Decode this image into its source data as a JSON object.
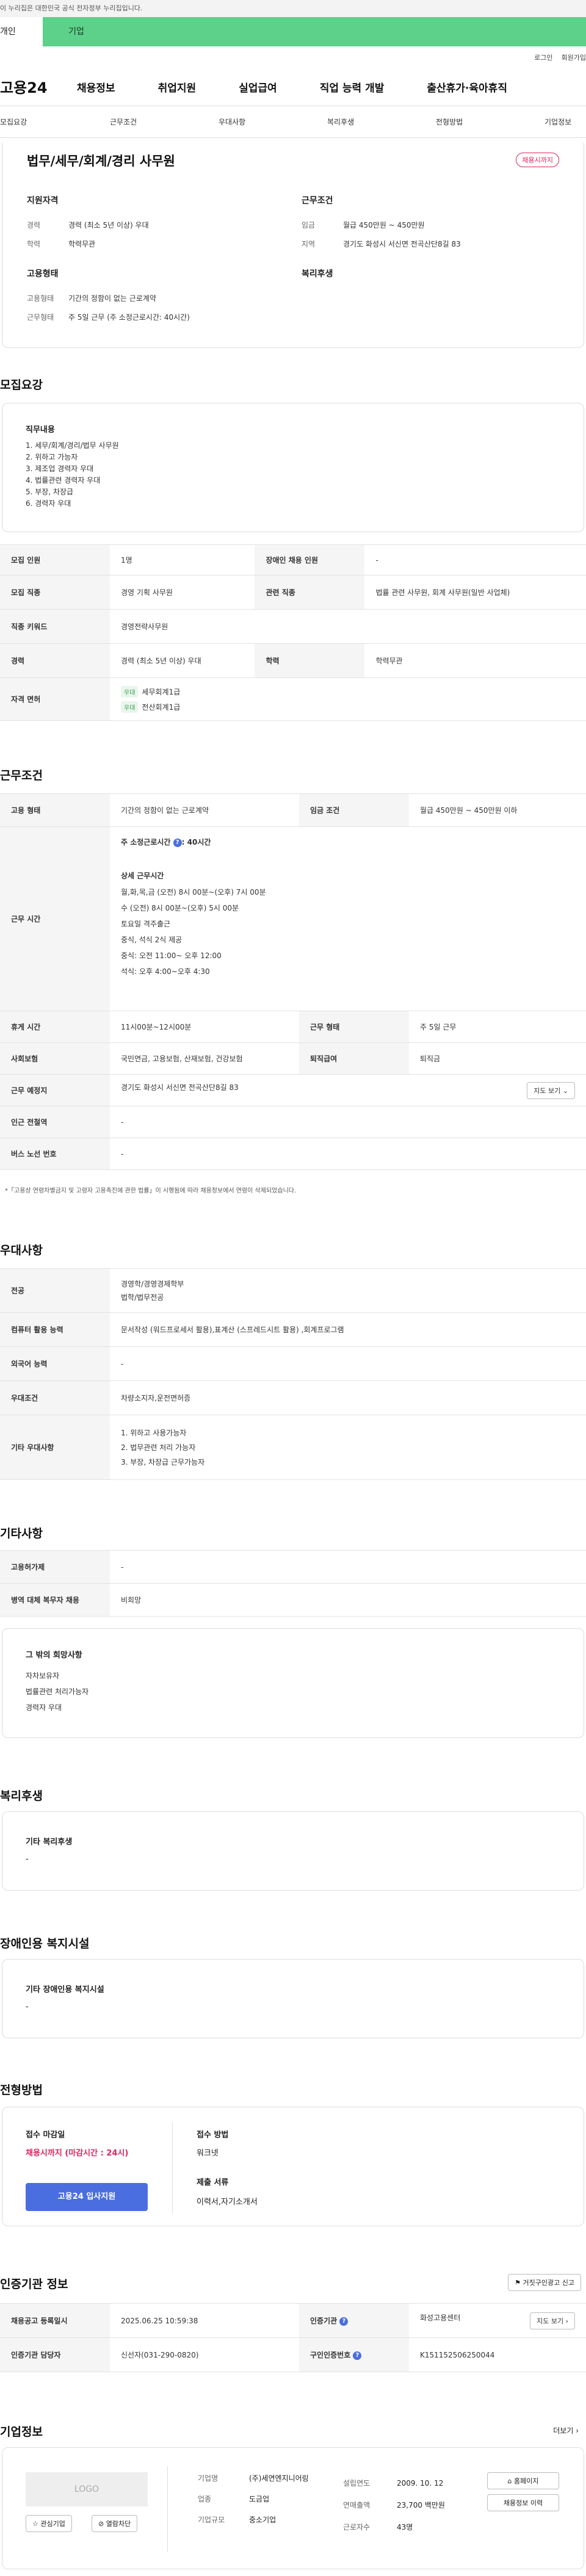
{
  "gov_banner": "이 누리집은 대한민국 공식 전자정부 누리집입니다.",
  "persona_tabs": [
    "개인",
    "기업"
  ],
  "util": [
    "로그인",
    "회원가입"
  ],
  "logo": "고용24",
  "gnb": [
    "채용정보",
    "취업지원",
    "실업급여",
    "직업 능력 개발",
    "출산휴가·육아휴직"
  ],
  "subnav": [
    "모집요강",
    "근무조건",
    "우대사항",
    "복리후생",
    "전형방법",
    "기업정보"
  ],
  "job": {
    "title": "법무/세무/회계/경리 사무원",
    "status": "채용시까지",
    "qual_title": "지원자격",
    "career_label": "경력",
    "career": "경력 (최소 5년 이상) 우대",
    "edu_label": "학력",
    "edu": "학력무관",
    "cond_title": "근무조건",
    "wage_label": "임금",
    "wage": "월급 450만원 ~ 450만원",
    "region_label": "지역",
    "region": "경기도 화성시 서신면 전곡산단8길 83",
    "emp_title": "고용형태",
    "emp_type_label": "고용형태",
    "emp_type": "기간의 정함이 없는 근로계약",
    "work_label": "근무형태",
    "work": "주 5일 근무 (주 소정근로시간: 40시간)",
    "welfare_title": "복리후생"
  },
  "recruit": {
    "title": "모집요강",
    "duty_title": "직무내용",
    "duties": [
      "1. 세무/회계/경리/법무 사무원",
      "2. 위하고 가능자",
      "3. 제조업 경력자 우대",
      "4. 법률관련 경력자 우대",
      "5. 부장, 차장급",
      "6. 경력자 우대"
    ],
    "rows": [
      [
        "모집 인원",
        "1명",
        "장애인 채용 인원",
        "-"
      ],
      [
        "모집 직종",
        "경영 기획 사무원",
        "관련 직종",
        "법률 관련 사무원, 회계 사무원(일반 사업체)"
      ],
      [
        "직종 키워드",
        "경영전략사무원"
      ],
      [
        "경력",
        "경력 (최소 5년 이상) 우대",
        "학력",
        "학력무관"
      ]
    ],
    "license_label": "자격 면허",
    "licenses": [
      {
        "badge": "우대",
        "name": "세무회계1급"
      },
      {
        "badge": "우대",
        "name": "전산회계1급"
      }
    ]
  },
  "condition": {
    "title": "근무조건",
    "emp_label": "고용 형태",
    "emp": "기간의 정함이 없는 근로계약",
    "wage_label": "임금 조건",
    "wage": "월급 450만원 ~ 450만원 이하",
    "hours_label": "근무 시간",
    "hours_week": "주 소정근로시간",
    "hours_week_val": ": 40시간",
    "detail_title": "상세 근무시간",
    "detail": [
      "월,화,목,금 (오전) 8시 00분~(오후) 7시 00분",
      "수 (오전) 8시 00분~(오후) 5시 00분",
      "토요일 격주출근",
      "중식, 석식 2식 제공",
      "중식: 오전 11:00~ 오후 12:00",
      "석식: 오후 4:00~오후 4:30"
    ],
    "rest_label": "휴게 시간",
    "rest": "11시00분~12시00분",
    "form_label": "근무 형태",
    "form": "주 5일 근무",
    "ins_label": "사회보험",
    "ins": "국민연금, 고용보험, 산재보험, 건강보험",
    "ret_label": "퇴직급여",
    "ret": "퇴직금",
    "place_label": "근무 예정지",
    "place": "경기도 화성시 서신면 전곡산단8길 83",
    "map_btn": "지도 보기",
    "station_label": "인근 전철역",
    "station": "-",
    "bus_label": "버스 노선 번호",
    "bus": "-",
    "note": "*「고용상 연령차별금지 및 고령자 고용촉진에 관한 법률」이 시행됨에 따라 채용정보에서 연령이 삭제되었습니다."
  },
  "pref": {
    "title": "우대사항",
    "rows": [
      [
        "전공",
        "경영학/경영경제학부\n법학/법무전공"
      ],
      [
        "컴퓨터 활용 능력",
        "문서작성 (워드프로세서 활용),표계산 (스프레드시트 활용) ,회계프로그램"
      ],
      [
        "외국어 능력",
        "-"
      ],
      [
        "우대조건",
        "차량소지자,운전면허증"
      ],
      [
        "기타 우대사항",
        "1. 위하고 사용가능자\n2. 법무관련 처리 가능자\n3. 부장, 차장급 근무가능자"
      ]
    ]
  },
  "etc": {
    "title": "기타사항",
    "rows": [
      [
        "고용허가제",
        "-"
      ],
      [
        "병역 대체 복무자 채용",
        "비희망"
      ]
    ],
    "box_title": "그 밖의 희망사항",
    "box": [
      "자차보유자",
      "법률관련 처리가능자",
      "경력자 우대"
    ]
  },
  "welfare": {
    "title": "복리후생",
    "box_title": "기타 복리후생",
    "box": "-"
  },
  "disabled": {
    "title": "장애인용 복지시설",
    "box_title": "기타 장애인용 복지시설",
    "box": "-"
  },
  "screen": {
    "title": "전형방법",
    "deadline_title": "접수 마감일",
    "deadline": "채용시까지 (마감시간 : 24시)",
    "apply_btn": "고용24 입사지원",
    "method_title": "접수 방법",
    "method": "워크넷",
    "docs_title": "제출 서류",
    "docs": "이력서,자기소개서"
  },
  "auth": {
    "title": "인증기관 정보",
    "report_btn": "거짓구인광고 신고",
    "reg_label": "채용공고 등록일시",
    "reg": "2025.06.25 10:59:38",
    "org_label": "인증기관",
    "org": "화성고용센터",
    "map_btn": "지도 보기",
    "mgr_label": "인증기관 담당자",
    "mgr": "신선자(031-290-0820)",
    "num_label": "구인인증번호",
    "num": "K151152506250044"
  },
  "company": {
    "title": "기업정보",
    "more": "더보기",
    "logo": "LOGO",
    "fav_btn": "관심기업",
    "block_btn": "열람차단",
    "name_label": "기업명",
    "name": "(주)세연엔지니어링",
    "ind_label": "업종",
    "ind": "도금업",
    "size_label": "기업규모",
    "size": "중소기업",
    "year_label": "설립연도",
    "year": "2009. 10. 12",
    "sales_label": "연매출액",
    "sales": "23,700 백만원",
    "emp_label": "근로자수",
    "emp": "43명",
    "home_btn": "홈페이지",
    "jobs_btn": "채용정보 이력"
  },
  "colors": {
    "green": "#5dd08a",
    "red": "#e0245e",
    "blue": "#4a6ee0"
  }
}
